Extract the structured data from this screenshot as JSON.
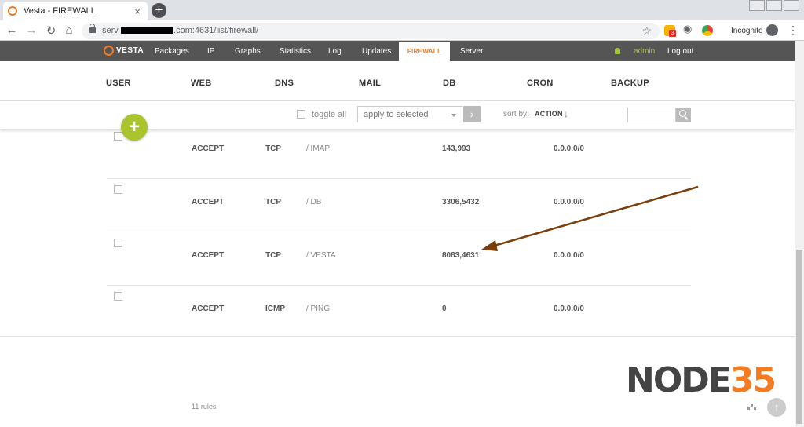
{
  "browser": {
    "tab_title": "Vesta - FIREWALL",
    "tab_close": "×",
    "new_tab": "+",
    "url_prefix": "serv.",
    "url_suffix": ".com:4631/list/firewall/",
    "incognito_label": "Incognito",
    "extension_badge": "3"
  },
  "topnav": {
    "logo": "VESTA",
    "items": [
      "Packages",
      "IP",
      "Graphs",
      "Statistics",
      "Log",
      "Updates",
      "FIREWALL",
      "Server"
    ],
    "active": "FIREWALL",
    "user": "admin",
    "logout": "Log out"
  },
  "sections": [
    "USER",
    "WEB",
    "DNS",
    "MAIL",
    "DB",
    "CRON",
    "BACKUP"
  ],
  "toolbar": {
    "toggle_all": "toggle all",
    "bulk_action": "apply to selected",
    "sort_by_label": "sort by:",
    "sort_by_value": "ACTION",
    "sort_arrow": "↓"
  },
  "rules": [
    {
      "action": "ACCEPT",
      "protocol": "TCP",
      "comment": "/ IMAP",
      "port": "143,993",
      "ip": "0.0.0.0/0"
    },
    {
      "action": "ACCEPT",
      "protocol": "TCP",
      "comment": "/ DB",
      "port": "3306,5432",
      "ip": "0.0.0.0/0"
    },
    {
      "action": "ACCEPT",
      "protocol": "TCP",
      "comment": "/ VESTA",
      "port": "8083,4631",
      "ip": "0.0.0.0/0"
    },
    {
      "action": "ACCEPT",
      "protocol": "ICMP",
      "comment": "/ PING",
      "port": "0",
      "ip": "0.0.0.0/0"
    }
  ],
  "footer": {
    "count": "11 rules",
    "brand_part1": "NODE",
    "brand_part2": "35"
  },
  "colors": {
    "accent": "#f47b20",
    "nav_bg": "#555555",
    "add_button": "#a9c42c",
    "annotation_arrow": "#7a3f0c"
  }
}
